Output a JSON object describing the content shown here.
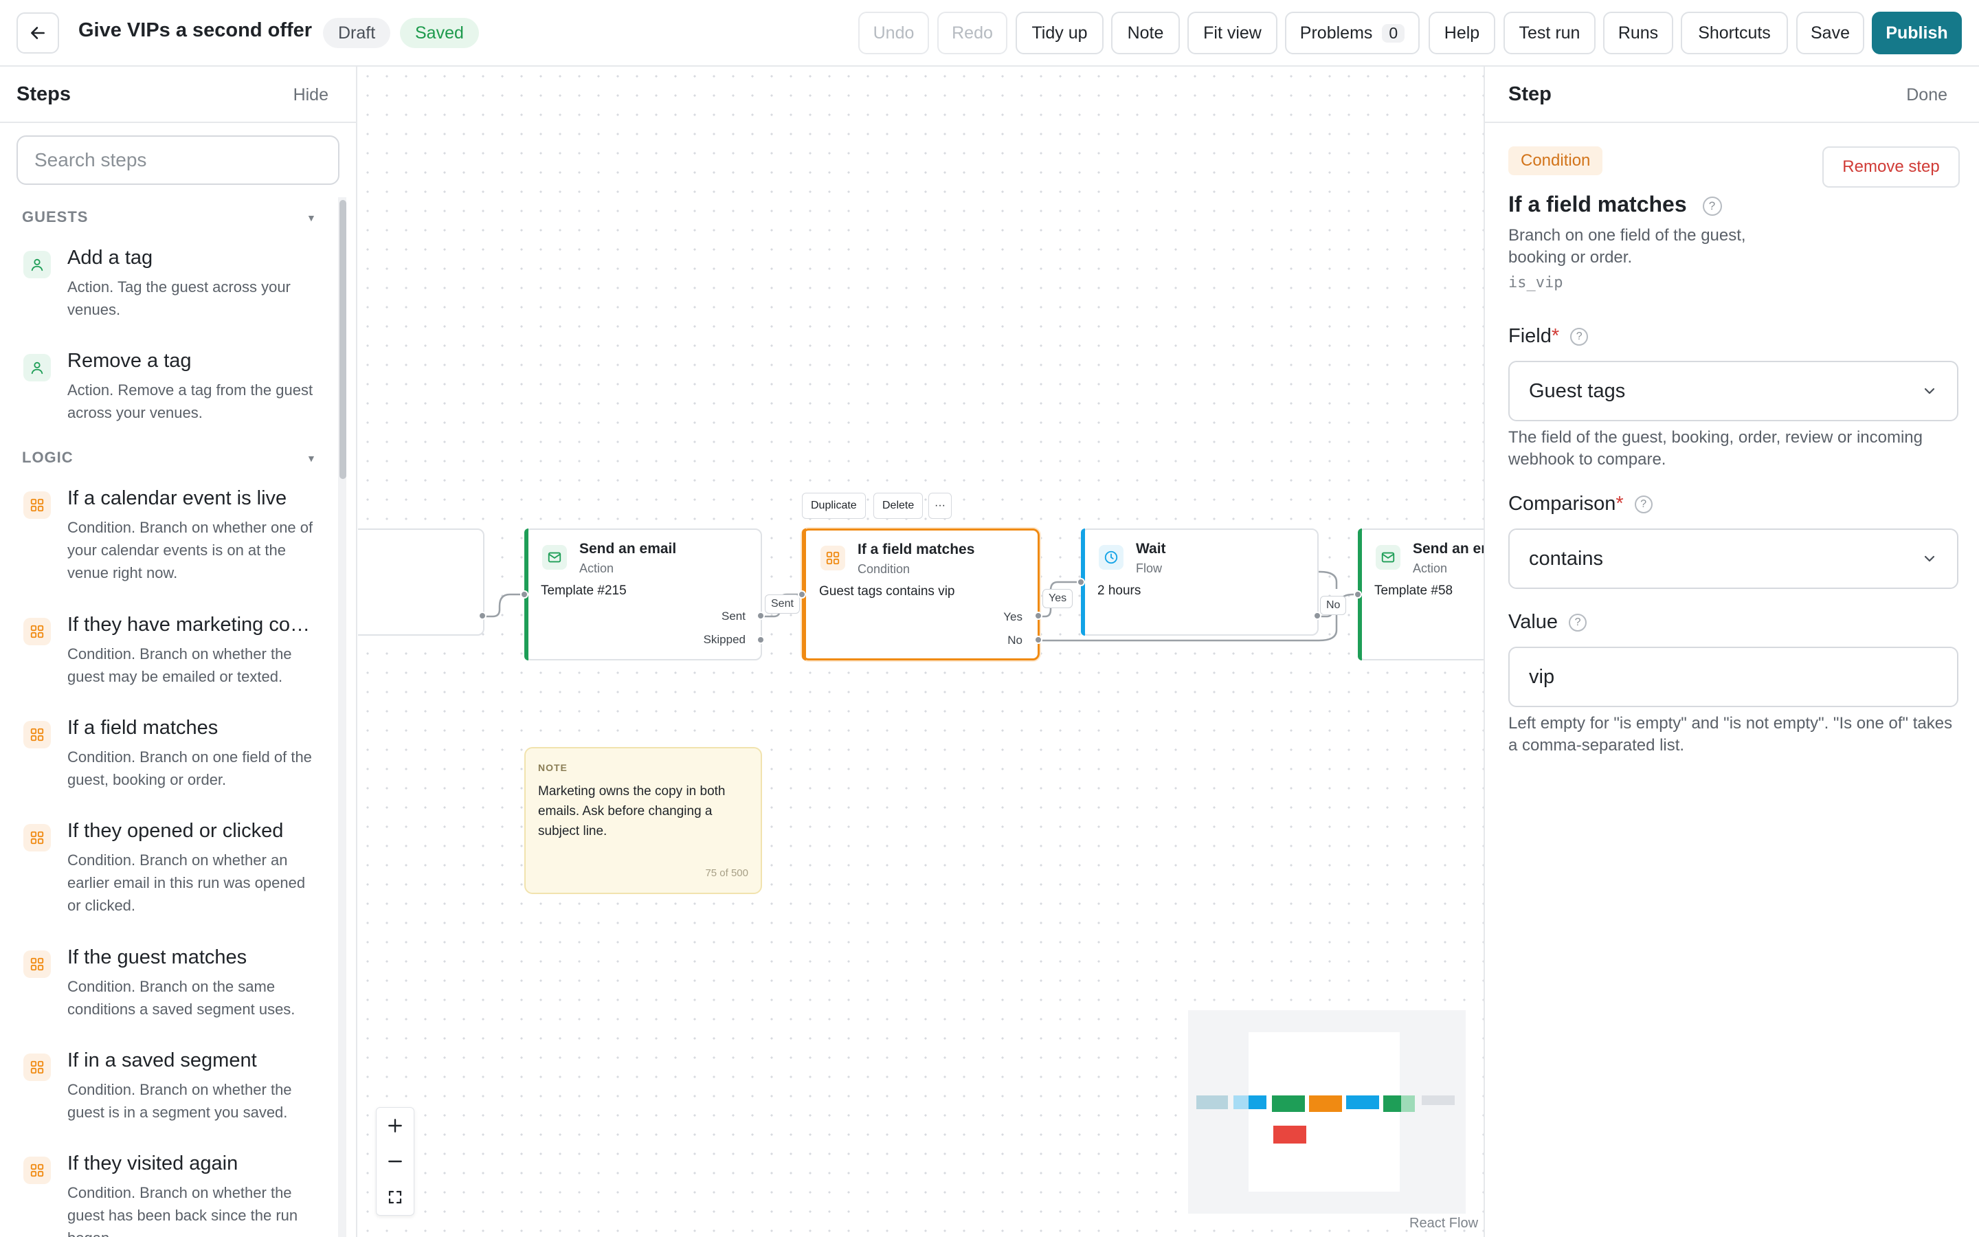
{
  "header": {
    "title": "Give VIPs a second offer",
    "status_draft": "Draft",
    "status_saved": "Saved",
    "buttons": {
      "undo": "Undo",
      "redo": "Redo",
      "tidy_up": "Tidy up",
      "note": "Note",
      "fit_view": "Fit view",
      "problems": "Problems",
      "problems_count": "0",
      "help": "Help",
      "test_run": "Test run",
      "runs": "Runs",
      "shortcuts": "Shortcuts",
      "save": "Save",
      "publish": "Publish"
    },
    "accent_color": "#15798a"
  },
  "sidebar": {
    "title": "Steps",
    "hide_label": "Hide",
    "search_placeholder": "Search steps",
    "groups": [
      {
        "name": "GUESTS",
        "items": [
          {
            "name": "Add a tag",
            "desc": "Action. Tag the guest across your venues.",
            "icon": "person-icon"
          },
          {
            "name": "Remove a tag",
            "desc": "Action. Remove a tag from the guest across your venues.",
            "icon": "person-icon"
          }
        ]
      },
      {
        "name": "LOGIC",
        "items": [
          {
            "name": "If a calendar event is live",
            "desc": "Condition. Branch on whether one of your calendar events is on at the venue right now.",
            "icon": "grid-icon"
          },
          {
            "name": "If they have marketing co…",
            "desc": "Condition. Branch on whether the guest may be emailed or texted.",
            "icon": "grid-icon"
          },
          {
            "name": "If a field matches",
            "desc": "Condition. Branch on one field of the guest, booking or order.",
            "icon": "grid-icon"
          },
          {
            "name": "If they opened or clicked",
            "desc": "Condition. Branch on whether an earlier email in this run was opened or clicked.",
            "icon": "grid-icon"
          },
          {
            "name": "If the guest matches",
            "desc": "Condition. Branch on the same conditions a saved segment uses.",
            "icon": "grid-icon"
          },
          {
            "name": "If in a saved segment",
            "desc": "Condition. Branch on whether the guest is in a segment you saved.",
            "icon": "grid-icon"
          },
          {
            "name": "If they visited again",
            "desc": "Condition. Branch on whether the guest has been back since the run began.",
            "icon": "grid-icon"
          }
        ]
      }
    ]
  },
  "canvas": {
    "node_toolbar": {
      "duplicate": "Duplicate",
      "delete": "Delete",
      "more": "···"
    },
    "nodes": {
      "email1": {
        "title": "Send an email",
        "kind": "Action",
        "body": "Template #215",
        "port_sent": "Sent",
        "port_skipped": "Skipped"
      },
      "condition": {
        "title": "If a field matches",
        "kind": "Condition",
        "body": "Guest tags contains vip",
        "port_yes": "Yes",
        "port_no": "No"
      },
      "wait": {
        "title": "Wait",
        "kind": "Flow",
        "body": "2 hours"
      },
      "email2": {
        "title": "Send an email",
        "kind": "Action",
        "body": "Template #58"
      }
    },
    "edge_labels": {
      "sent": "Sent",
      "yes": "Yes",
      "no": "No"
    },
    "note": {
      "tag": "NOTE",
      "text": "Marketing owns the copy in both emails. Ask before changing a subject line.",
      "count": "75 of 500"
    },
    "attribution": "React Flow",
    "colors": {
      "action": "#1e9e57",
      "condition": "#f08a12",
      "flow": "#12a3e6",
      "grid_dot": "#d7dadf"
    }
  },
  "panel": {
    "title": "Step",
    "done_label": "Done",
    "kind_badge": "Condition",
    "remove_label": "Remove step",
    "step_name": "If a field matches",
    "step_desc": "Branch on one field of the guest, booking or order.",
    "step_key": "is_vip",
    "field": {
      "label": "Field",
      "value": "Guest tags",
      "help": "The field of the guest, booking, order, review or incoming webhook to compare."
    },
    "comparison": {
      "label": "Comparison",
      "value": "contains"
    },
    "value_field": {
      "label": "Value",
      "value": "vip",
      "help": "Left empty for \"is empty\" and \"is not empty\". \"Is one of\" takes a comma-separated list."
    },
    "badge_color": "#d2741a",
    "danger_color": "#d03b36"
  }
}
